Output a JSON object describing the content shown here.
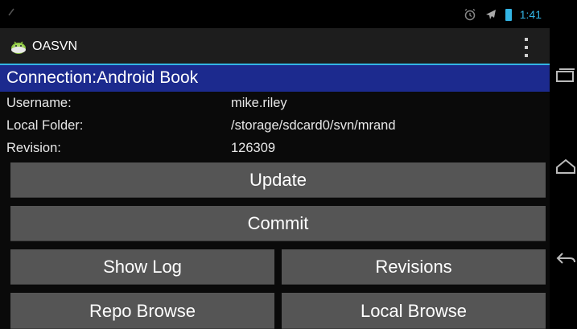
{
  "status_bar": {
    "time": "1:41",
    "left_icon": "signal-icon",
    "icons": [
      "alarm-icon",
      "airplane-mode-icon",
      "battery-icon"
    ],
    "accent_color": "#33b5e5"
  },
  "action_bar": {
    "app_name": "OASVN",
    "app_icon": "android-app-icon",
    "overflow_icon": "overflow-menu-icon"
  },
  "connection": {
    "title": "Connection:Android Book",
    "header_color": "#1c2a8e"
  },
  "info": {
    "username_label": "Username:",
    "username_value": "mike.riley",
    "folder_label": "Local Folder:",
    "folder_value": "/storage/sdcard0/svn/mrand",
    "revision_label": "Revision:",
    "revision_value": "126309"
  },
  "buttons": {
    "update": "Update",
    "commit": "Commit",
    "show_log": "Show Log",
    "revisions": "Revisions",
    "repo_browse": "Repo Browse",
    "local_browse": "Local Browse"
  },
  "nav_bar": {
    "icons": [
      "recent-apps-icon",
      "home-icon",
      "back-icon"
    ]
  }
}
